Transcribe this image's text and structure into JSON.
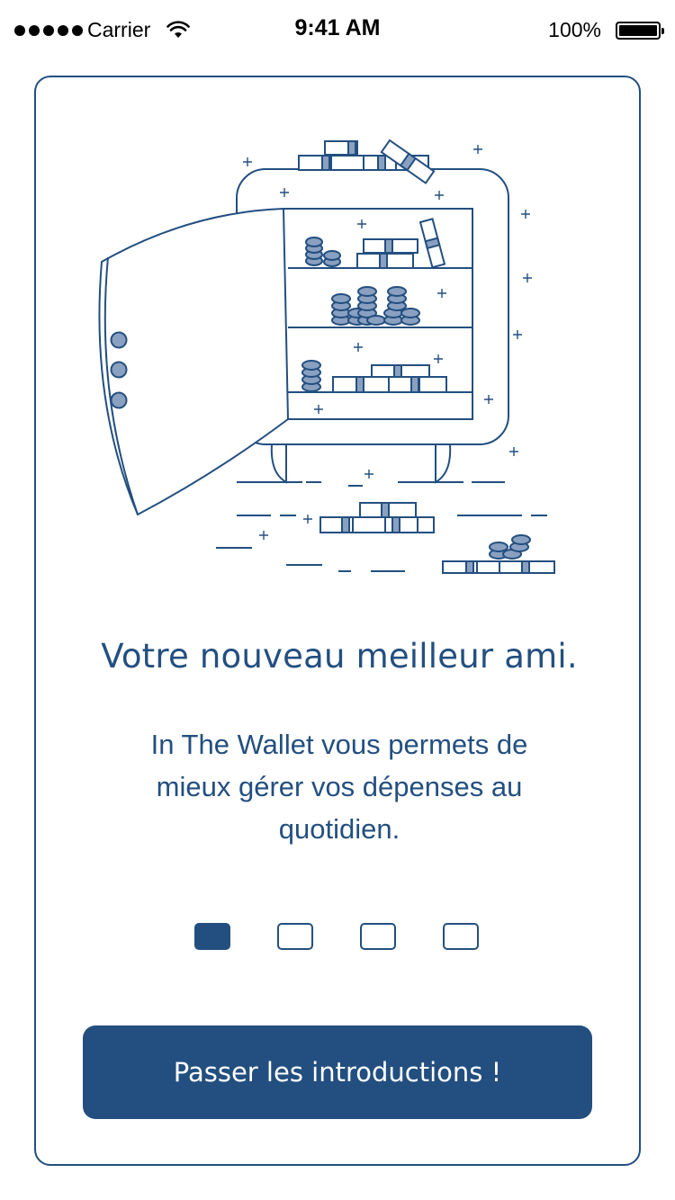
{
  "status_bar": {
    "carrier": "Carrier",
    "time": "9:41 AM",
    "battery_percent": "100%",
    "signal_icon": "signal-dots-icon",
    "wifi_icon": "wifi-icon",
    "battery_icon": "battery-icon"
  },
  "onboarding": {
    "illustration_icon": "open-safe-with-gold-bars-and-coins-illustration",
    "title": "Votre nouveau meilleur ami.",
    "description_lines": [
      "In The Wallet vous permets de",
      "mieux gérer vos dépenses au",
      "quotidien."
    ],
    "page_indicator": {
      "total": 4,
      "current": 1
    },
    "skip_label": "Passer les introductions !"
  },
  "colors": {
    "accent": "#234f80",
    "illustration_fill": "#8aa0c0",
    "background": "#ffffff"
  }
}
